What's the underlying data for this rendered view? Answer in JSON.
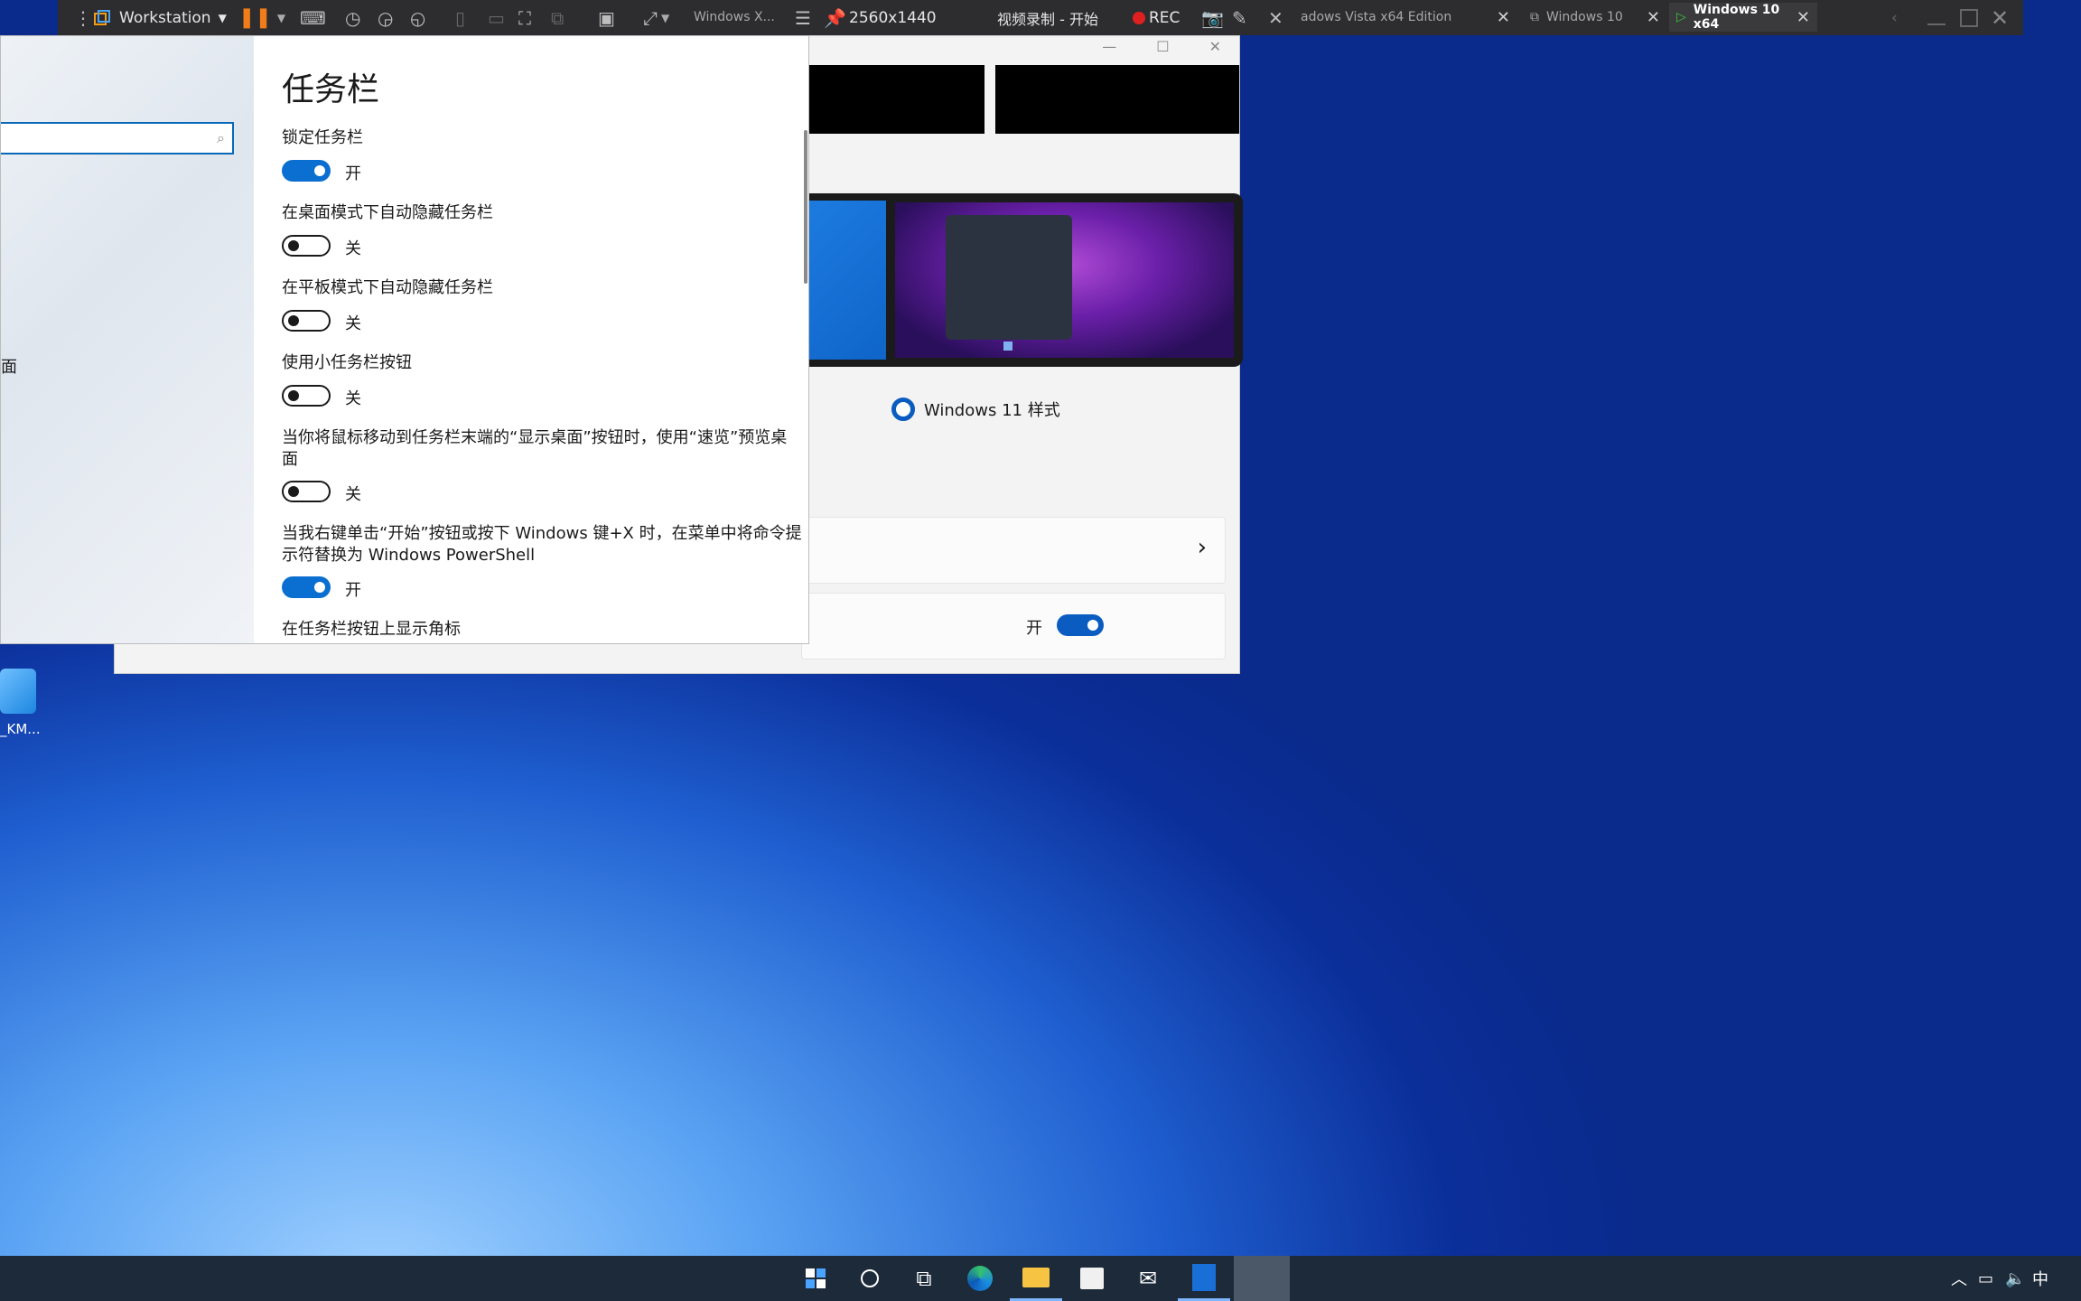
{
  "vm_toolbar": {
    "app_name": "Workstation",
    "resolution": "2560x1440",
    "recording_label": "视频录制 - 开始",
    "rec_button": "REC",
    "tabs": [
      {
        "label": "Windows X..."
      },
      {
        "label": "adows Vista x64 Edition"
      },
      {
        "label": "Windows 10"
      },
      {
        "label": "Windows 10 x64",
        "active": true
      }
    ]
  },
  "settings": {
    "title": "任务栏",
    "partial_left_text": "面",
    "items": [
      {
        "label": "锁定任务栏",
        "state": "开",
        "on": true
      },
      {
        "label": "在桌面模式下自动隐藏任务栏",
        "state": "关",
        "on": false
      },
      {
        "label": "在平板模式下自动隐藏任务栏",
        "state": "关",
        "on": false
      },
      {
        "label": "使用小任务栏按钮",
        "state": "关",
        "on": false
      },
      {
        "label_line1": "当你将鼠标移动到任务栏末端的“显示桌面”按钮时，使用“速览”预览桌",
        "label_line2": "面",
        "state": "关",
        "on": false
      },
      {
        "label_line1": "当我右键单击“开始”按钮或按下 Windows 键+X 时，在菜单中将命令提",
        "label_line2": "示符替换为 Windows PowerShell",
        "state": "开",
        "on": true
      },
      {
        "label": "在任务栏按钮上显示角标"
      }
    ]
  },
  "back_window": {
    "win11_option": "Windows 11 样式",
    "toggle_state": "开"
  },
  "desktop": {
    "icon_label": "_KM..."
  },
  "colors": {
    "accent": "#0a6fd0",
    "toolbar": "#2d2d30",
    "taskbar": "#1c2a3a"
  }
}
